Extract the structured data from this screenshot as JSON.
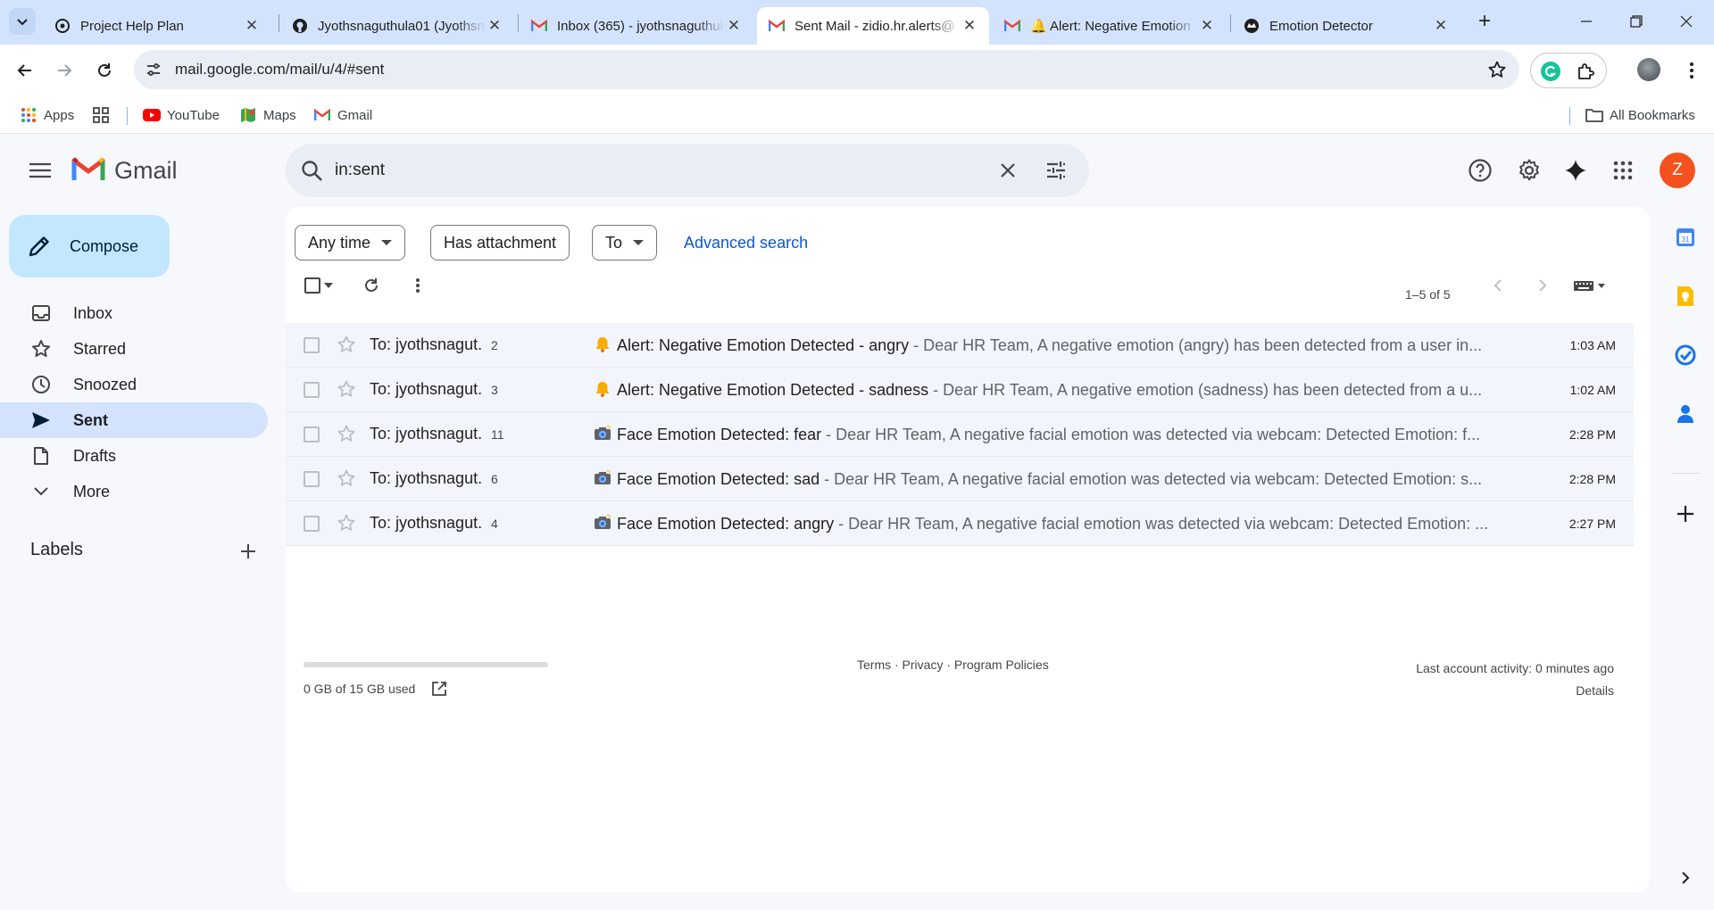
{
  "browser": {
    "tabs": [
      {
        "title": "Project Help Plan",
        "icon": "chatgpt-icon",
        "active": false
      },
      {
        "title": "Jyothsnaguthula01 (Jyothsna",
        "icon": "github-icon",
        "active": false
      },
      {
        "title": "Inbox (365) - jyothsnaguthula",
        "icon": "gmail-icon",
        "active": false
      },
      {
        "title": "Sent Mail - zidio.hr.alerts@",
        "icon": "gmail-icon",
        "active": true
      },
      {
        "title": "🔔 Alert: Negative Emotion",
        "icon": "gmail-icon",
        "active": false
      },
      {
        "title": "Emotion Detector",
        "icon": "app-icon",
        "active": false
      }
    ],
    "url": "mail.google.com/mail/u/4/#sent",
    "bookmarks": [
      {
        "label": "Apps",
        "icon": "apps-grid-icon"
      },
      {
        "label": "",
        "icon": "tab-groups-icon"
      },
      {
        "label": "YouTube",
        "icon": "youtube-icon"
      },
      {
        "label": "Maps",
        "icon": "maps-icon"
      },
      {
        "label": "Gmail",
        "icon": "gmail-icon"
      }
    ],
    "all_bookmarks": "All Bookmarks"
  },
  "gmail": {
    "logo_text": "Gmail",
    "search_query": "in:sent",
    "profile_initial": "Z",
    "compose_label": "Compose",
    "nav": [
      "Inbox",
      "Starred",
      "Snoozed",
      "Sent",
      "Drafts",
      "More"
    ],
    "active_nav": "Sent",
    "labels_title": "Labels",
    "filters": [
      "Any time",
      "Has attachment",
      "To"
    ],
    "advanced_search": "Advanced search",
    "count_text": "1–5 of 5",
    "emails": [
      {
        "to": "To: jyothsnagut.",
        "count": "2",
        "emoji": "bell",
        "subject": "Alert: Negative Emotion Detected - angry",
        "snippet": "Dear HR Team, A negative emotion (angry) has been detected from a user in...",
        "time": "1:03 AM"
      },
      {
        "to": "To: jyothsnagut.",
        "count": "3",
        "emoji": "bell",
        "subject": "Alert: Negative Emotion Detected - sadness",
        "snippet": "Dear HR Team, A negative emotion (sadness) has been detected from a u...",
        "time": "1:02 AM"
      },
      {
        "to": "To: jyothsnagut.",
        "count": "11",
        "emoji": "camera",
        "subject": "Face Emotion Detected: fear",
        "snippet": "Dear HR Team, A negative facial emotion was detected via webcam: Detected Emotion: f...",
        "time": "2:28 PM"
      },
      {
        "to": "To: jyothsnagut.",
        "count": "6",
        "emoji": "camera",
        "subject": "Face Emotion Detected: sad",
        "snippet": "Dear HR Team, A negative facial emotion was detected via webcam: Detected Emotion: s...",
        "time": "2:28 PM"
      },
      {
        "to": "To: jyothsnagut.",
        "count": "4",
        "emoji": "camera",
        "subject": "Face Emotion Detected: angry",
        "snippet": "Dear HR Team, A negative facial emotion was detected via webcam: Detected Emotion: ...",
        "time": "2:27 PM"
      }
    ],
    "storage_text": "0 GB of 15 GB used",
    "storage_fraction": 0.0,
    "footer_links": "Terms · Privacy · Program Policies",
    "activity_text": "Last account activity: 0 minutes ago",
    "details_link": "Details"
  },
  "colors": {
    "accent": "#0b57d0",
    "compose_bg": "#c2e7ff",
    "active_nav_bg": "#d3e3fd",
    "profile_bg": "#f4511e",
    "tabstrip_bg": "#d3e3fd"
  }
}
